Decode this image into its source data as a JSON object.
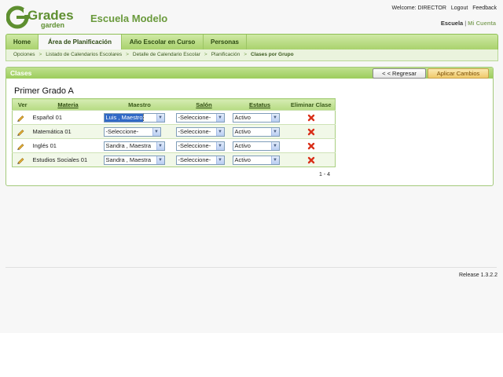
{
  "brand": {
    "logo_line1": "Grades",
    "logo_line2": "garden",
    "school_name": "Escuela Modelo"
  },
  "top_links": {
    "welcome": "Welcome: DIRECTOR",
    "logout": "Logout",
    "feedback": "Feedback"
  },
  "account_links": {
    "escuela": "Escuela",
    "separator": "|",
    "mi_cuenta": "Mi Cuenta"
  },
  "tabs": [
    {
      "label": "Home"
    },
    {
      "label": "Área de Planificación"
    },
    {
      "label": "Año Escolar en Curso"
    },
    {
      "label": "Personas"
    }
  ],
  "breadcrumb": {
    "items": [
      "Opciones",
      "Listado de Calendarios Escolares",
      "Detalle de Calendario Escolar",
      "Planificación"
    ],
    "current": "Clases por Grupo",
    "separator": ">"
  },
  "panel": {
    "title": "Clases",
    "back_button": "< < Regresar",
    "apply_button": "Aplicar Cambios"
  },
  "group_title": "Primer Grado A",
  "table": {
    "headers": {
      "ver": "Ver",
      "materia": "Materia",
      "maestro": "Maestro",
      "salon": "Salón",
      "estatus": "Estatus",
      "eliminar": "Eliminar Clase"
    },
    "rows": [
      {
        "materia": "Español 01",
        "maestro": "Luis , Maestro",
        "salon": "-Seleccione-",
        "estatus": "Activo"
      },
      {
        "materia": "Matemática 01",
        "maestro": "-Seleccione-",
        "salon": "-Seleccione-",
        "estatus": "Activo"
      },
      {
        "materia": "Inglés 01",
        "maestro": "Sandra , Maestra",
        "salon": "-Seleccione-",
        "estatus": "Activo"
      },
      {
        "materia": "Estudios Sociales 01",
        "maestro": "Sandra , Maestra",
        "salon": "-Seleccione-",
        "estatus": "Activo"
      }
    ]
  },
  "pager": "1 - 4",
  "release": "Release 1.3.2.2",
  "icons": {
    "edit": "pencil-icon",
    "delete": "delete-x-icon",
    "dropdown": "chevron-down-icon"
  },
  "colors": {
    "brand_green": "#6a9a3c",
    "nav_green": "#a9d26d",
    "apply_orange": "#f0c96a",
    "delete_red": "#d9301a"
  }
}
